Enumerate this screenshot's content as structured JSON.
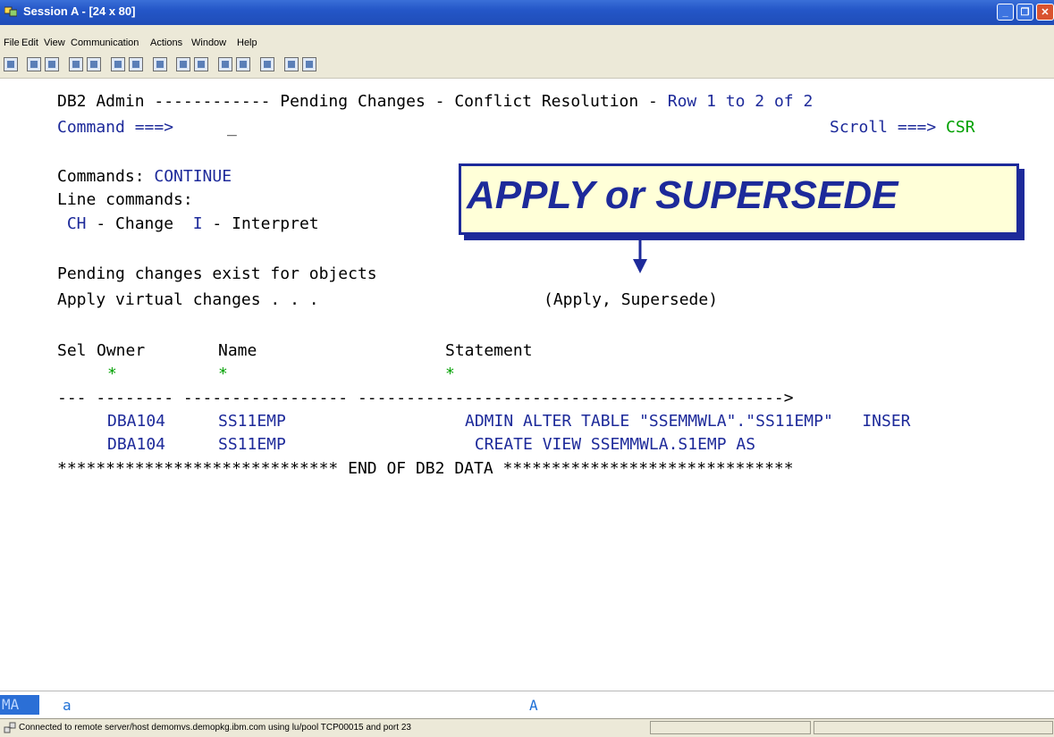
{
  "window": {
    "title": "Session A - [24 x 80]",
    "buttons": {
      "minimize": "_",
      "restore": "❐",
      "close": "✕"
    }
  },
  "menu": [
    "File",
    "Edit",
    "View",
    "Communication",
    "Actions",
    "Window",
    "Help"
  ],
  "screen": {
    "header_left": "DB2 Admin ------------ Pending Changes - Conflict Resolution - ",
    "header_row": "Row 1 to 2 of 2",
    "command_label": "Command ===> ",
    "command_value": "_",
    "scroll_label": "Scroll ===> ",
    "scroll_value": "CSR",
    "commands_label": "Commands: ",
    "commands_value": "CONTINUE",
    "line_commands_label": "Line commands:",
    "lc_ch": "CH",
    "lc_ch_desc": " - Change  ",
    "lc_i": "I",
    "lc_i_desc": " - Interpret",
    "pending_msg": "Pending changes exist for objects",
    "apply_label": "Apply virtual changes . . .",
    "apply_options": "(Apply, Supersede)",
    "col_sel": "Sel",
    "col_owner": "Owner",
    "col_name": "Name",
    "col_statement": "Statement",
    "filter_star": "*",
    "separator": "--- -------- ----------------- -------------------------------------------->",
    "rows": [
      {
        "owner": "DBA104",
        "name": "SS11EMP",
        "statement": "ADMIN ALTER TABLE \"SSEMMWLA\".\"SS11EMP\"   INSER"
      },
      {
        "owner": "DBA104",
        "name": "SS11EMP",
        "statement": " CREATE VIEW SSEMMWLA.S1EMP AS"
      }
    ],
    "end_line": "***************************** END OF DB2 DATA ******************************"
  },
  "callout": {
    "text": "APPLY or SUPERSEDE"
  },
  "oia": {
    "mode": "MA",
    "indicator_a": "a",
    "indicator_A": "A"
  },
  "statusbar": {
    "message": "Connected to remote server/host demomvs.demopkg.ibm.com using lu/pool TCP00015 and port 23"
  },
  "colors": {
    "field_blue": "#1d2a9a",
    "field_green": "#00a000",
    "callout_bg": "#ffffd8"
  }
}
